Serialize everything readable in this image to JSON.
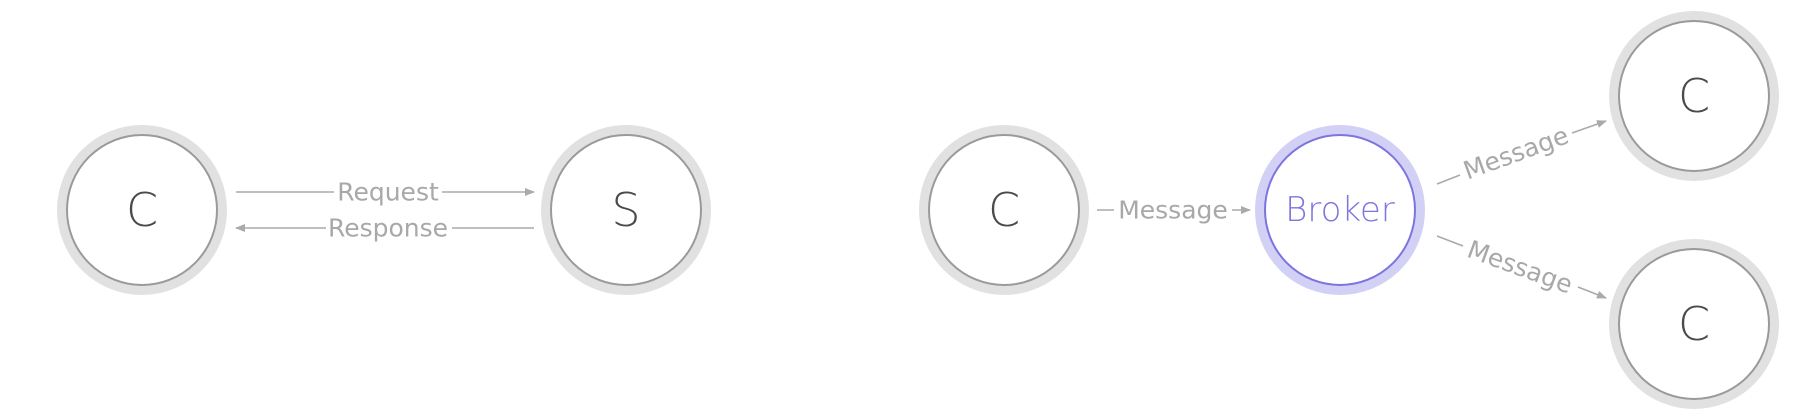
{
  "colors": {
    "ring": "#e1e1e1",
    "node_border": "#9a9a9a",
    "node_text": "#4a4a4a",
    "edge": "#aaaaaa",
    "edge_text": "#a8a8a8",
    "accent": "#7d74df",
    "accent_ring": "#d2d0f5"
  },
  "request_response": {
    "client_label": "C",
    "server_label": "S",
    "request_label": "Request",
    "response_label": "Response"
  },
  "broker_pattern": {
    "producer_label": "C",
    "broker_label": "Broker",
    "consumer_top_label": "C",
    "consumer_bottom_label": "C",
    "message_in_label": "Message",
    "message_out_top_label": "Message",
    "message_out_bottom_label": "Message"
  }
}
